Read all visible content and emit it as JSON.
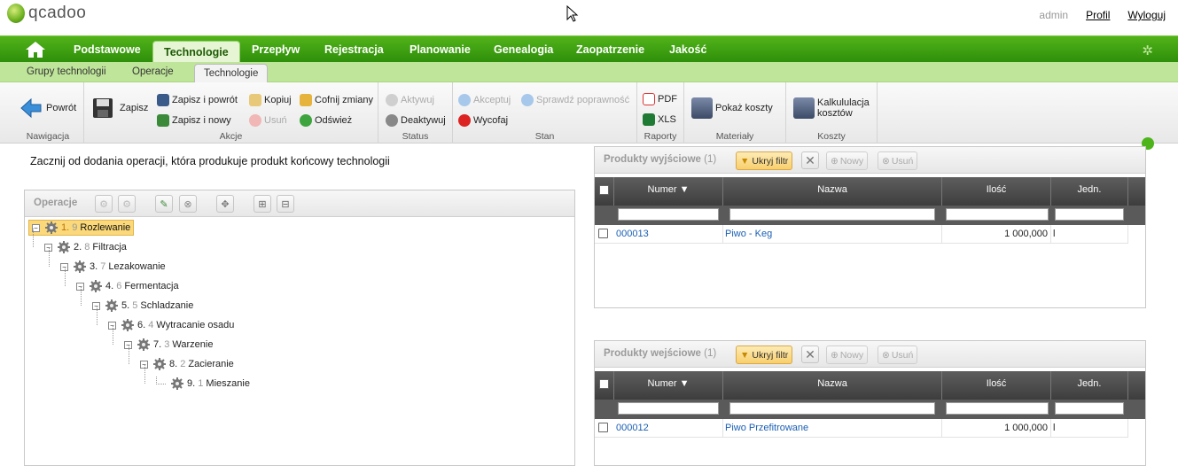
{
  "app": {
    "logo_text": "qcadoo",
    "user": "admin",
    "profile_link": "Profil",
    "logout_link": "Wyloguj"
  },
  "mainnav": {
    "items": [
      "Podstawowe",
      "Technologie",
      "Przepływ",
      "Rejestracja",
      "Planowanie",
      "Genealogia",
      "Zaopatrzenie",
      "Jakość"
    ],
    "active": "Technologie"
  },
  "subnav": {
    "items": [
      "Grupy technologii",
      "Operacje",
      "Technologie"
    ],
    "active": "Technologie"
  },
  "ribbon": {
    "groups": [
      "Nawigacja",
      "Akcje",
      "Status",
      "Stan",
      "Raporty",
      "Materiały",
      "Koszty"
    ],
    "back": "Powrót",
    "save": "Zapisz",
    "save_back": "Zapisz i powrót",
    "save_new": "Zapisz i nowy",
    "copy": "Kopiuj",
    "delete": "Usuń",
    "undo": "Cofnij zmiany",
    "refresh": "Odśwież",
    "activate": "Aktywuj",
    "deactivate": "Deaktywuj",
    "accept": "Akceptuj",
    "check": "Sprawdź poprawność",
    "withdraw": "Wycofaj",
    "pdf": "PDF",
    "xls": "XLS",
    "show_costs": "Pokaż koszty",
    "cost_calc_1": "Kalkululacja",
    "cost_calc_2": "kosztów"
  },
  "hint": "Zacznij od dodania operacji, która produkuje produkt końcowy technologii",
  "operations": {
    "title": "Operacje",
    "nodes": [
      {
        "num": "1.",
        "seq": "9",
        "name": "Rozlewanie"
      },
      {
        "num": "2.",
        "seq": "8",
        "name": "Filtracja"
      },
      {
        "num": "3.",
        "seq": "7",
        "name": "Lezakowanie"
      },
      {
        "num": "4.",
        "seq": "6",
        "name": "Fermentacja"
      },
      {
        "num": "5.",
        "seq": "5",
        "name": "Schladzanie"
      },
      {
        "num": "6.",
        "seq": "4",
        "name": "Wytracanie osadu"
      },
      {
        "num": "7.",
        "seq": "3",
        "name": "Warzenie"
      },
      {
        "num": "8.",
        "seq": "2",
        "name": "Zacieranie"
      },
      {
        "num": "9.",
        "seq": "1",
        "name": "Mieszanie"
      }
    ]
  },
  "output_products": {
    "title": "Produkty wyjściowe",
    "count": "(1)",
    "filter_btn": "Ukryj filtr",
    "new_btn": "Nowy",
    "delete_btn": "Usuń",
    "columns": [
      "Numer",
      "Nazwa",
      "Ilość",
      "Jedn."
    ],
    "rows": [
      {
        "number": "000013",
        "name": "Piwo - Keg",
        "qty": "1 000,000",
        "unit": "l"
      }
    ]
  },
  "input_products": {
    "title": "Produkty wejściowe",
    "count": "(1)",
    "filter_btn": "Ukryj filtr",
    "new_btn": "Nowy",
    "delete_btn": "Usuń",
    "columns": [
      "Numer",
      "Nazwa",
      "Ilość",
      "Jedn."
    ],
    "rows": [
      {
        "number": "000012",
        "name": "Piwo Przefitrowane",
        "qty": "1 000,000",
        "unit": "l"
      }
    ]
  }
}
